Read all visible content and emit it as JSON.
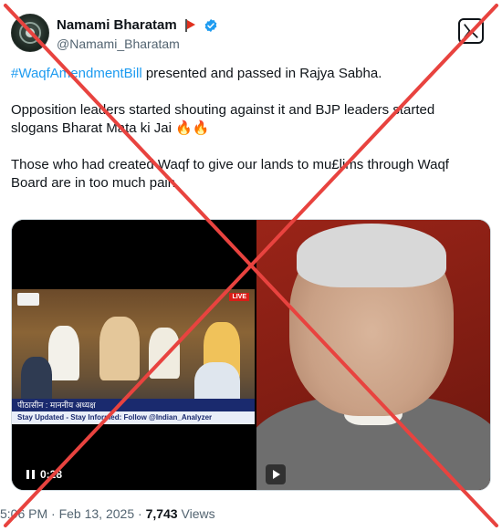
{
  "header": {
    "display_name": "Namami Bharatam",
    "handle": "@Namami_Bharatam",
    "flag_icon": "red-flag-emoji",
    "verified_icon": "blue-check-icon",
    "logo_icon": "x-logo-icon"
  },
  "tweet": {
    "hashtag": "#WaqfAmendmentBill",
    "line1_rest": " presented and passed in Rajya Sabha.",
    "para2": "Opposition leaders started shouting against it and BJP leaders started slogans Bharat Mata ki Jai 🔥🔥",
    "para3": "Those who had created Waqf to give our lands to mu£lims through Waqf Board are in too much pain"
  },
  "media": {
    "left_video": {
      "live_label": "LIVE",
      "caption": "पीठासीन : माननीय अध्यक्ष",
      "ticker": "Stay Updated - Stay Informed: Follow @Indian_Analyzer",
      "timestamp": "0:28"
    },
    "right_video": {
      "icon": "play-icon"
    }
  },
  "meta": {
    "time": "5:06 PM",
    "separator": "·",
    "date": "Feb 13, 2025",
    "views_count": "7,743",
    "views_label": "Views"
  },
  "colors": {
    "accent": "#1d9bf0",
    "overlay_cross": "#e8433f",
    "text": "#0f1419",
    "muted": "#536471"
  }
}
